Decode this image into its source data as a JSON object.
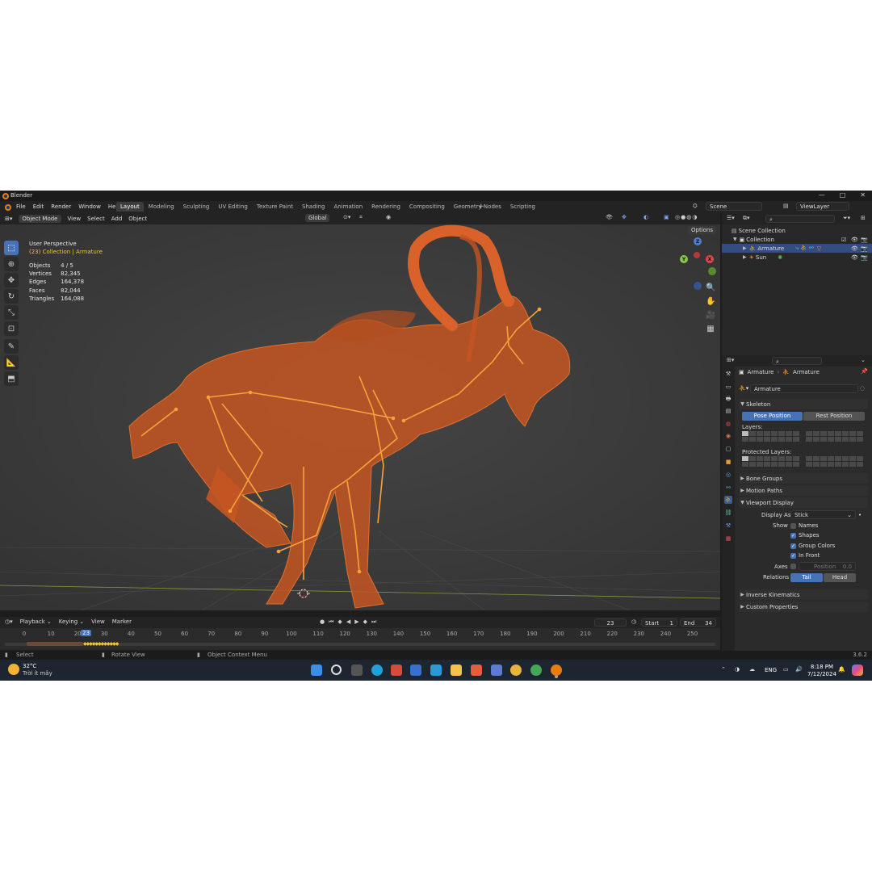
{
  "titlebar": {
    "title": "Blender",
    "min": "—",
    "max": "□",
    "close": "✕"
  },
  "menu": [
    "File",
    "Edit",
    "Render",
    "Window",
    "Help"
  ],
  "workspaces": [
    "Layout",
    "Modeling",
    "Sculpting",
    "UV Editing",
    "Texture Paint",
    "Shading",
    "Animation",
    "Rendering",
    "Compositing",
    "Geometry Nodes",
    "Scripting"
  ],
  "active_workspace": "Layout",
  "scene": "Scene",
  "view_layer": "ViewLayer",
  "viewport_header": {
    "mode": "Object Mode",
    "menus": [
      "View",
      "Select",
      "Add",
      "Object"
    ],
    "orientation": "Global",
    "options": "Options"
  },
  "viewport_info": {
    "perspective": "User Perspective",
    "collection": "(23) Collection | Armature"
  },
  "stats": [
    {
      "label": "Objects",
      "value": "4 / 5"
    },
    {
      "label": "Vertices",
      "value": "82,345"
    },
    {
      "label": "Edges",
      "value": "164,378"
    },
    {
      "label": "Faces",
      "value": "82,044"
    },
    {
      "label": "Triangles",
      "value": "164,088"
    }
  ],
  "gizmo": {
    "x": "X",
    "y": "Y",
    "z": "Z"
  },
  "timeline": {
    "menus": [
      "Playback",
      "Keying",
      "View",
      "Marker"
    ],
    "current_frame": "23",
    "start_label": "Start",
    "start": "1",
    "end_label": "End",
    "end": "34",
    "ticks": [
      "0",
      "10",
      "20",
      "30",
      "40",
      "50",
      "60",
      "70",
      "80",
      "90",
      "100",
      "110",
      "120",
      "130",
      "140",
      "150",
      "160",
      "170",
      "180",
      "190",
      "200",
      "210",
      "220",
      "230",
      "240",
      "250"
    ]
  },
  "statusbar": {
    "select": "Select",
    "rotate": "Rotate View",
    "context": "Object Context Menu",
    "version": "3.6.2"
  },
  "outliner": {
    "scene_collection": "Scene Collection",
    "collection": "Collection",
    "armature": "Armature",
    "sun": "Sun"
  },
  "properties": {
    "breadcrumb_a": "Armature",
    "breadcrumb_b": "Armature",
    "name": "Armature",
    "skeleton": "Skeleton",
    "pose_position": "Pose Position",
    "rest_position": "Rest Position",
    "layers": "Layers:",
    "protected_layers": "Protected Layers:",
    "bone_groups": "Bone Groups",
    "motion_paths": "Motion Paths",
    "viewport_display": "Viewport Display",
    "display_as_label": "Display As",
    "display_as": "Stick",
    "show_label": "Show",
    "names": "Names",
    "shapes": "Shapes",
    "group_colors": "Group Colors",
    "in_front": "In Front",
    "axes_label": "Axes",
    "position": "Position",
    "position_value": "0.0",
    "relations_label": "Relations",
    "tail": "Tail",
    "head": "Head",
    "inverse_kinematics": "Inverse Kinematics",
    "custom_properties": "Custom Properties"
  },
  "taskbar": {
    "temp": "32°C",
    "weather": "Trời ít mây",
    "lang": "ENG",
    "time": "8:18 PM",
    "date": "7/12/2024"
  },
  "colors": {
    "accent": "#4772b3",
    "mesh": "#d9622b",
    "bones": "#f5a33b",
    "selected_row": "#334d80"
  }
}
